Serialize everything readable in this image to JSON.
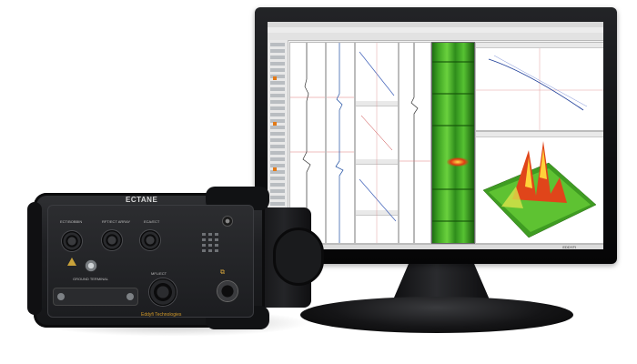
{
  "scene": {
    "monitor": {
      "status_text": "EDDYFI"
    },
    "device": {
      "brand": "ECTANE",
      "company": "Eddyfi Technologies",
      "ports": [
        {
          "label": "ECT/BOBBIN"
        },
        {
          "label": "RFT/ECT ARRAY"
        },
        {
          "label": "ECA/ECT"
        },
        {
          "label": "MFL/ECT"
        }
      ],
      "ground_label": "GROUND TERMINAL"
    },
    "colors": {
      "device_body": "#1e1f22",
      "monitor_bezel": "#0d0e10",
      "cscan_green": "#3fa523",
      "accent_orange": "#e27a18",
      "label_gold": "#d29a2a"
    }
  }
}
